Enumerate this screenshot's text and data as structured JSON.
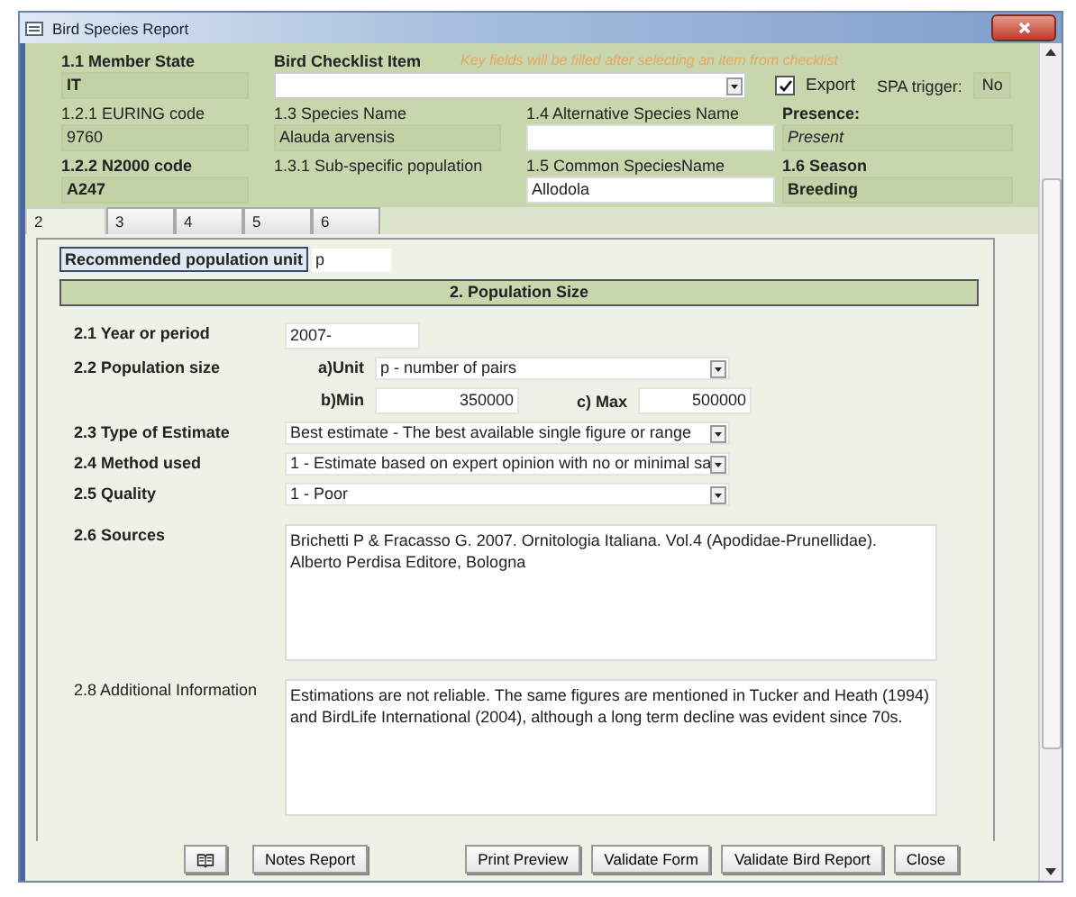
{
  "window": {
    "title": "Bird Species Report"
  },
  "header": {
    "member_state": {
      "label": "1.1 Member State",
      "value": "IT"
    },
    "checklist": {
      "label": "Bird Checklist Item",
      "hint": "Key fields will be filled after selecting an item from checklist"
    },
    "export": {
      "label": "Export",
      "checked": true
    },
    "spa_trigger": {
      "label": "SPA trigger:",
      "value": "No"
    },
    "rows": [
      [
        {
          "label": "1.2.1 EURING code",
          "value": "9760",
          "kind": "flat",
          "label_bold": false,
          "value_bold": false,
          "value_italic": false
        },
        {
          "label": "1.3 Species Name",
          "value": "Alauda arvensis",
          "kind": "flat",
          "label_bold": false,
          "value_bold": false,
          "value_italic": false
        },
        {
          "label": "1.4 Alternative Species Name",
          "kind": "input",
          "label_bold": false
        },
        {
          "label": "Presence:",
          "value": "Present",
          "kind": "flat",
          "label_bold": true,
          "value_bold": false,
          "value_italic": true
        }
      ],
      [
        {
          "label": "1.2.2 N2000 code",
          "value": "A247",
          "kind": "flat",
          "label_bold": true,
          "value_bold": true,
          "value_italic": false
        },
        {
          "label": "1.3.1 Sub-specific population",
          "kind": "none",
          "label_bold": false
        },
        {
          "label": "1.5 Common SpeciesName",
          "value": "Allodola",
          "kind": "input",
          "label_bold": false,
          "value_bold": false,
          "value_italic": false
        },
        {
          "label": "1.6 Season",
          "value": "Breeding",
          "kind": "flat",
          "label_bold": true,
          "value_bold": true,
          "value_italic": false
        }
      ]
    ]
  },
  "tabs": [
    {
      "label": "2",
      "selected": true
    },
    {
      "label": "3",
      "selected": false
    },
    {
      "label": "4",
      "selected": false
    },
    {
      "label": "5",
      "selected": false
    },
    {
      "label": "6",
      "selected": false
    }
  ],
  "panel": {
    "recommended_unit": {
      "label": "Recommended population unit",
      "value": "p"
    },
    "section_title": "2. Population Size",
    "rows": [
      {
        "kind": "text",
        "label": "2.1 Year or period",
        "value": "2007-",
        "label_bold": true
      },
      {
        "kind": "size",
        "label": "2.2 Population size",
        "label_bold": true,
        "unit_label": "a)Unit",
        "unit": "p - number of pairs",
        "min_label": "b)Min",
        "min": "350000",
        "max_label": "c) Max",
        "max": "500000"
      },
      {
        "kind": "combo",
        "label": "2.3 Type of Estimate",
        "value": "Best estimate - The best available single figure or range",
        "label_bold": true
      },
      {
        "kind": "combo",
        "label": "2.4 Method used",
        "value": "1 - Estimate based on expert opinion with no or minimal sa",
        "label_bold": true
      },
      {
        "kind": "combo",
        "label": "2.5 Quality",
        "value": "1 - Poor",
        "label_bold": true
      },
      {
        "kind": "memo",
        "label": "2.6 Sources",
        "value": "Brichetti P & Fracasso G. 2007. Ornitologia Italiana. Vol.4 (Apodidae-Prunellidae). Alberto Perdisa Editore, Bologna",
        "label_bold": true
      },
      {
        "kind": "memo",
        "label": "2.8 Additional Information",
        "value": "Estimations are not reliable. The same figures are mentioned in Tucker and Heath (1994) and BirdLife International (2004), although a long term decline was evident since 70s.",
        "label_bold": false
      }
    ]
  },
  "buttons": [
    {
      "kind": "icon"
    },
    {
      "kind": "text",
      "label": "Notes Report"
    },
    {
      "kind": "gap"
    },
    {
      "kind": "text",
      "label": "Print Preview"
    },
    {
      "kind": "text",
      "label": "Validate Form"
    },
    {
      "kind": "text",
      "label": "Validate Bird Report"
    },
    {
      "kind": "text",
      "label": "Close"
    }
  ]
}
